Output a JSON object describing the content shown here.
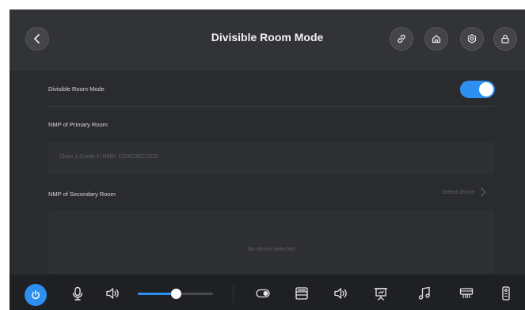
{
  "header": {
    "title": "Divisible Room Mode",
    "buttons": [
      "back",
      "link",
      "home",
      "settings",
      "lock"
    ]
  },
  "settings": {
    "divisible_label": "Divisible Room Mode",
    "divisible_enabled": true,
    "primary_label": "NMP of Primary Room",
    "primary_value": "Class 1 Grade 1/ NMP/ 1204C00C12C6",
    "secondary_label": "NMP of Secondary Room",
    "select_device": "Select device",
    "empty_text": "No device selected"
  },
  "bottombar": {
    "volume_level": 0.5,
    "icons": [
      "power-icon",
      "microphone-icon",
      "speaker-icon",
      "toggle-icon",
      "device-icon",
      "speaker-icon",
      "presentation-icon",
      "music-icon",
      "projector-icon",
      "remote-icon"
    ]
  },
  "colors": {
    "accent": "#2d8ff0",
    "background": "#2a2b2f",
    "header": "#323337",
    "bottombar": "#1f2023"
  }
}
